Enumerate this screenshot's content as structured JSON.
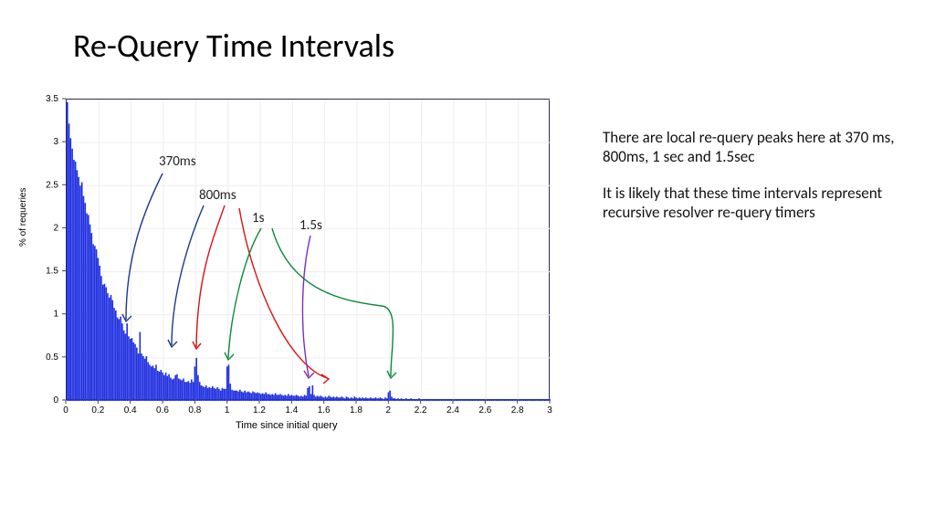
{
  "title": "Re-Query Time Intervals",
  "side": {
    "p1": "There are local re-query peaks here at 370 ms, 800ms, 1 sec and 1.5sec",
    "p2": "It is likely that these time intervals represent recursive resolver re-query timers"
  },
  "annotations": {
    "a370": "370ms",
    "a800": "800ms",
    "a1s": "1s",
    "a15s": "1.5s"
  },
  "chart_data": {
    "type": "bar",
    "title": "",
    "xlabel": "Time since initial query",
    "ylabel": "% of requeries",
    "xlim": [
      0,
      3
    ],
    "ylim": [
      0,
      3.5
    ],
    "xticks": [
      0,
      0.2,
      0.4,
      0.6,
      0.8,
      1,
      1.2,
      1.4,
      1.6,
      1.8,
      2,
      2.2,
      2.4,
      2.6,
      2.8,
      3
    ],
    "yticks": [
      0,
      0.5,
      1,
      1.5,
      2,
      2.5,
      3,
      3.5
    ],
    "bin_width": 0.01,
    "peaks": [
      {
        "x": 0.37,
        "label": "370ms"
      },
      {
        "x": 0.8,
        "label": "800ms"
      },
      {
        "x": 1.0,
        "label": "1s"
      },
      {
        "x": 1.5,
        "label": "1.5s"
      }
    ],
    "values": [
      3.47,
      3.22,
      3.05,
      2.93,
      2.8,
      2.78,
      2.68,
      2.6,
      2.5,
      2.54,
      2.38,
      2.3,
      2.18,
      2.16,
      2.05,
      1.95,
      1.82,
      1.8,
      1.76,
      1.66,
      1.57,
      1.45,
      1.35,
      1.36,
      1.32,
      1.25,
      1.2,
      1.23,
      1.17,
      1.08,
      1.05,
      0.97,
      0.95,
      0.98,
      0.9,
      0.82,
      0.78,
      0.9,
      0.75,
      0.72,
      0.73,
      0.68,
      0.66,
      0.62,
      0.55,
      0.8,
      0.55,
      0.52,
      0.49,
      0.52,
      0.45,
      0.42,
      0.4,
      0.41,
      0.38,
      0.42,
      0.35,
      0.34,
      0.36,
      0.33,
      0.3,
      0.33,
      0.29,
      0.31,
      0.27,
      0.25,
      0.26,
      0.3,
      0.31,
      0.26,
      0.25,
      0.24,
      0.26,
      0.22,
      0.22,
      0.23,
      0.21,
      0.25,
      0.22,
      0.4,
      0.5,
      0.3,
      0.22,
      0.18,
      0.17,
      0.16,
      0.18,
      0.15,
      0.16,
      0.15,
      0.17,
      0.15,
      0.14,
      0.16,
      0.14,
      0.12,
      0.15,
      0.14,
      0.14,
      0.4,
      0.42,
      0.2,
      0.13,
      0.12,
      0.12,
      0.12,
      0.11,
      0.13,
      0.11,
      0.1,
      0.12,
      0.1,
      0.11,
      0.1,
      0.09,
      0.11,
      0.1,
      0.09,
      0.1,
      0.09,
      0.08,
      0.09,
      0.08,
      0.1,
      0.08,
      0.08,
      0.07,
      0.08,
      0.07,
      0.09,
      0.07,
      0.07,
      0.08,
      0.07,
      0.06,
      0.07,
      0.06,
      0.08,
      0.06,
      0.07,
      0.06,
      0.06,
      0.07,
      0.06,
      0.05,
      0.06,
      0.05,
      0.07,
      0.06,
      0.15,
      0.17,
      0.08,
      0.18,
      0.07,
      0.05,
      0.06,
      0.05,
      0.06,
      0.05,
      0.04,
      0.05,
      0.04,
      0.06,
      0.05,
      0.04,
      0.05,
      0.04,
      0.05,
      0.04,
      0.04,
      0.05,
      0.04,
      0.03,
      0.05,
      0.04,
      0.03,
      0.04,
      0.03,
      0.05,
      0.04,
      0.03,
      0.04,
      0.03,
      0.04,
      0.03,
      0.04,
      0.03,
      0.03,
      0.04,
      0.03,
      0.03,
      0.04,
      0.03,
      0.03,
      0.04,
      0.03,
      0.02,
      0.04,
      0.03,
      0.1,
      0.12,
      0.05,
      0.03,
      0.03,
      0.02,
      0.03,
      0.02,
      0.03,
      0.02,
      0.02,
      0.03,
      0.02,
      0.02,
      0.03,
      0.02,
      0.02,
      0.02,
      0.02,
      0.03,
      0.02,
      0.02,
      0.02,
      0.02,
      0.02,
      0.02,
      0.02,
      0.02,
      0.02,
      0.02,
      0.02,
      0.02,
      0.02,
      0.02,
      0.02,
      0.02,
      0.02,
      0.02,
      0.02,
      0.02,
      0.02,
      0.02,
      0.02,
      0.02,
      0.02,
      0.02,
      0.02,
      0.02,
      0.02,
      0.02,
      0.02,
      0.02,
      0.02,
      0.02,
      0.02,
      0.02,
      0.02,
      0.02,
      0.02,
      0.02,
      0.02,
      0.02,
      0.02,
      0.02,
      0.02,
      0.02,
      0.02,
      0.02,
      0.02,
      0.02,
      0.02,
      0.02,
      0.02,
      0.02,
      0.02,
      0.02,
      0.02,
      0.02,
      0.02,
      0.02,
      0.02,
      0.02,
      0.02,
      0.02,
      0.02,
      0.02,
      0.02,
      0.02,
      0.02,
      0.02,
      0.02,
      0.02,
      0.02,
      0.02,
      0.02,
      0.02,
      0.02,
      0.02,
      0.02,
      0.02,
      0.02
    ]
  }
}
